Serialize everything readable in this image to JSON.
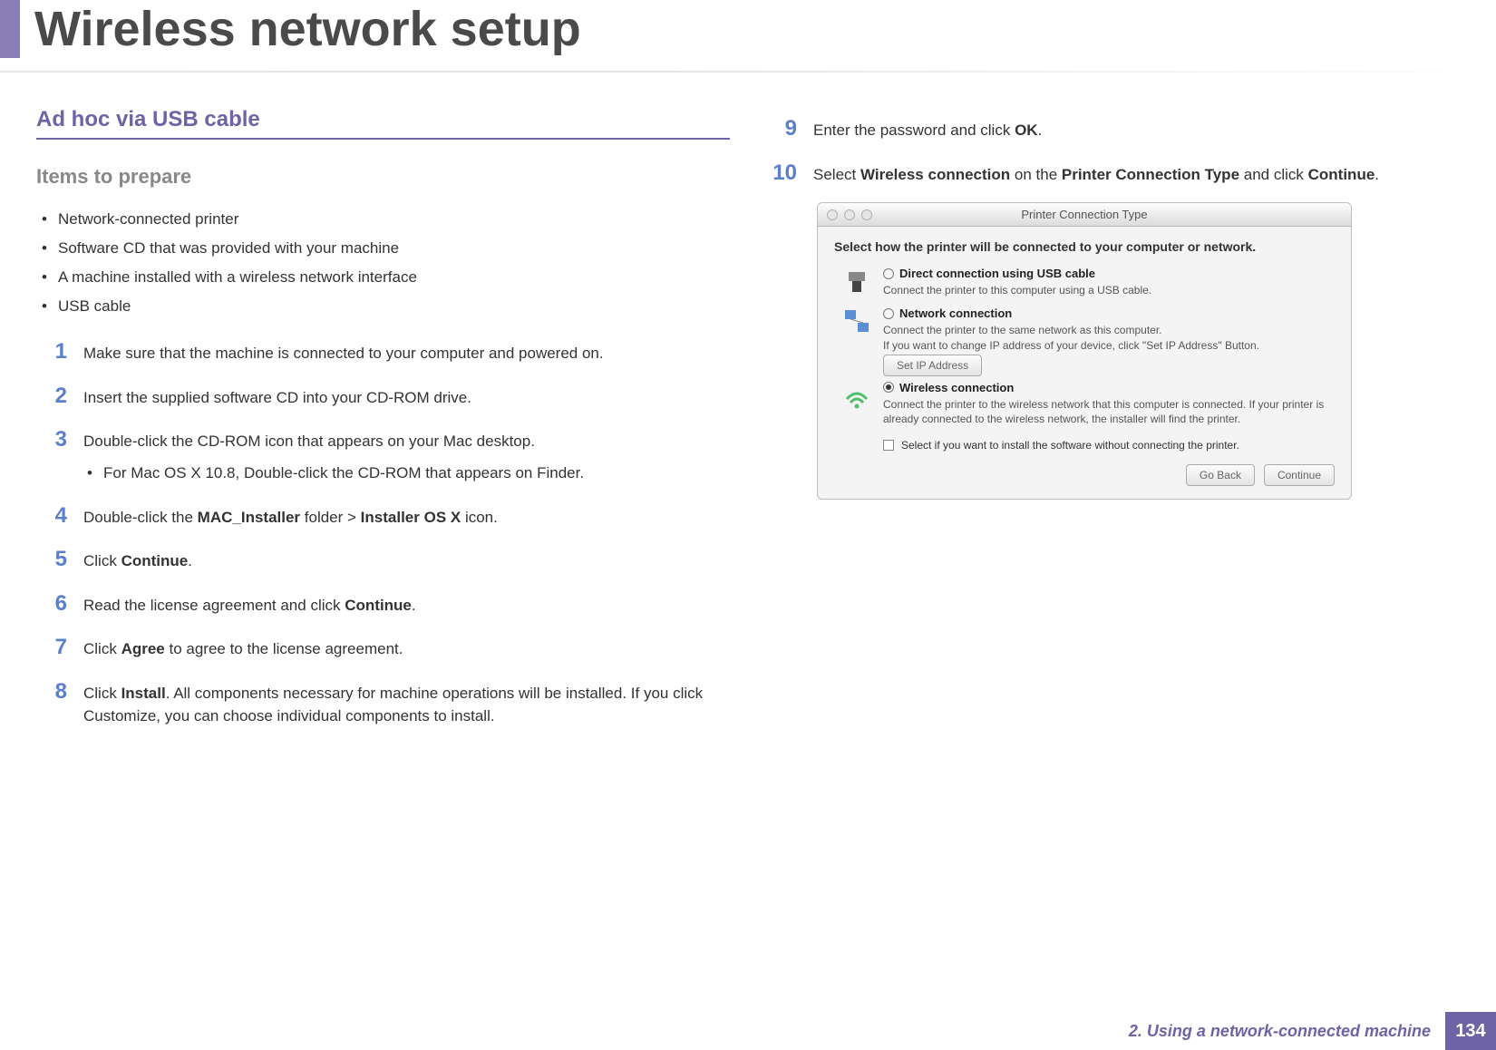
{
  "title": "Wireless network setup",
  "section": "Ad hoc via USB cable",
  "subheading": "Items to prepare",
  "items_to_prepare": [
    "Network-connected printer",
    "Software CD that was provided with your machine",
    "A machine installed with a wireless network interface",
    "USB cable"
  ],
  "steps_left": [
    {
      "n": "1",
      "text": "Make sure that the machine is connected to your computer and powered on."
    },
    {
      "n": "2",
      "text": "Insert the supplied software CD into your CD-ROM drive."
    },
    {
      "n": "3",
      "text": "Double-click the CD-ROM icon that appears on your Mac desktop.",
      "sub": "For Mac OS X 10.8, Double-click the CD-ROM that appears on Finder."
    },
    {
      "n": "4",
      "hseq": [
        "Double-click the ",
        "MAC_Installer",
        " folder > ",
        "Installer OS X",
        " icon."
      ]
    },
    {
      "n": "5",
      "hseq": [
        "Click ",
        "Continue",
        "."
      ]
    },
    {
      "n": "6",
      "hseq": [
        "Read the license agreement and click ",
        "Continue",
        "."
      ]
    },
    {
      "n": "7",
      "hseq": [
        "Click ",
        "Agree",
        " to agree to the license agreement."
      ]
    },
    {
      "n": "8",
      "hseq": [
        "Click ",
        "Install",
        ". All components necessary for machine operations will be installed. If you click Customize, you can choose individual components to install."
      ]
    }
  ],
  "steps_right": [
    {
      "n": "9",
      "hseq": [
        "Enter the password and click ",
        "OK",
        "."
      ]
    },
    {
      "n": "10",
      "hseq": [
        "Select ",
        "Wireless connection",
        " on the ",
        "Printer Connection Type",
        " and click ",
        "Continue",
        "."
      ]
    }
  ],
  "screenshot": {
    "title": "Printer Connection Type",
    "prompt": "Select how the printer will be connected to your computer or network.",
    "options": {
      "usb": {
        "label": "Direct connection using USB cable",
        "desc": "Connect the printer to this computer using a USB cable."
      },
      "net": {
        "label": "Network connection",
        "desc": "Connect the printer to the same network as this computer.\nIf you want to change IP address of your device, click \"Set IP Address\" Button."
      },
      "wifi": {
        "label": "Wireless connection",
        "desc": "Connect the printer to the wireless network that this computer is connected. If your printer is already connected to the wireless network, the installer will find the printer."
      }
    },
    "set_ip_label": "Set IP Address",
    "checkbox_label": "Select if you want to install the software without connecting the printer.",
    "go_back": "Go Back",
    "continue": "Continue"
  },
  "footer": {
    "chapter": "2.  Using a network-connected machine",
    "page": "134"
  }
}
